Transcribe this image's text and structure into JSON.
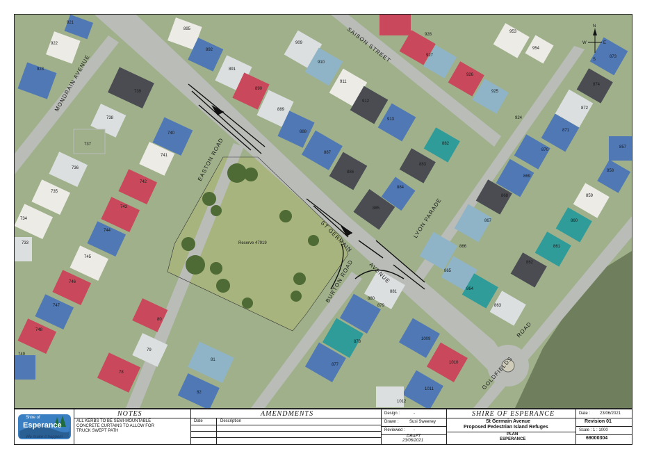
{
  "map": {
    "compass": {
      "north": "N",
      "south": "S",
      "east": "E",
      "west": "W"
    },
    "streets": [
      "SAISON STREET",
      "MONDRAIN AVENUE",
      "EASTON ROAD",
      "ST GERMAIN",
      "AVENUE",
      "BURTON ROAD",
      "LYON PARADE",
      "GOLDFIELDS",
      "ROAD"
    ],
    "reserve_label": "Reserve 47919",
    "lots": [
      "921",
      "922",
      "923",
      "895",
      "892",
      "891",
      "890",
      "889",
      "888",
      "887",
      "886",
      "885",
      "884",
      "883",
      "882",
      "909",
      "910",
      "911",
      "912",
      "913",
      "953",
      "954",
      "928",
      "927",
      "926",
      "925",
      "924",
      "873",
      "874",
      "872",
      "871",
      "870",
      "869",
      "868",
      "867",
      "866",
      "865",
      "864",
      "863",
      "862",
      "861",
      "860",
      "859",
      "858",
      "857",
      "739",
      "738",
      "737",
      "736",
      "735",
      "734",
      "741",
      "740",
      "742",
      "743",
      "744",
      "745",
      "746",
      "747",
      "748",
      "749",
      "733",
      "78",
      "79",
      "80",
      "81",
      "82",
      "879",
      "878",
      "877",
      "1009",
      "1010",
      "1011",
      "1012",
      "881",
      "880"
    ]
  },
  "title_block": {
    "notes_header": "NOTES",
    "notes_text_1": "ALL KERBS TO BE SEMI-MOUNTABLE",
    "notes_text_2": "CONCRETE CURTAINS TO ALLOW FOR",
    "notes_text_3": "TRUCK SWEPT PATH",
    "logo_text_1": "Shire of",
    "logo_text_2": "Esperance",
    "logo_text_3": "We make it happen!",
    "amendments_header": "AMENDMENTS",
    "col_date": "Date",
    "col_description": "Description",
    "design_label": "Design :",
    "design_value": "-",
    "drawn_label": "Drawn :",
    "drawn_value": "Susi Sweeney",
    "reviewed_label": "Reviewed :",
    "reviewed_value": "-",
    "draft_label": "DRAFT",
    "draft_date": "23/06/2021",
    "shire_header": "SHIRE OF ESPERANCE",
    "project_line_1": "St Germain Avenue",
    "project_line_2": "Proposed Pedestrian Island Refuges",
    "plan_label": "PLAN",
    "plan_location": "ESPERANCE",
    "date_label": "Date :",
    "date_value": "23/06/2021",
    "revision": "Revision 01",
    "scale_label": "Scale : 1 : 1000",
    "drawing_number": "69000304"
  }
}
